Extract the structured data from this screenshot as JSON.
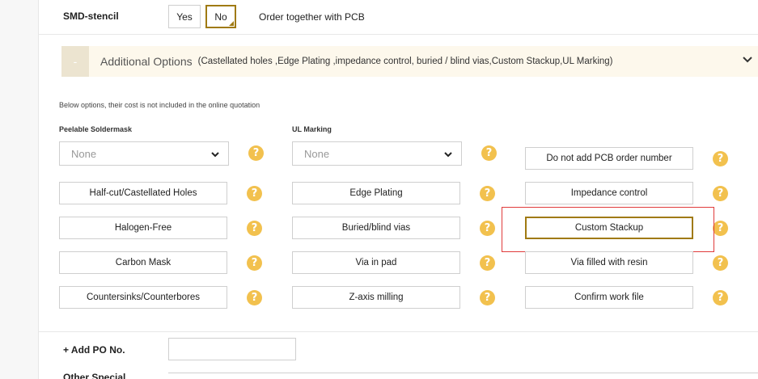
{
  "smd_stencil": {
    "label": "SMD-stencil",
    "yes_label": "Yes",
    "no_label": "No",
    "selected": "No",
    "note": "Order together with PCB"
  },
  "additional_options": {
    "toggle_symbol": "-",
    "title": "Additional Options",
    "subtitle": "(Castellated holes ,Edge Plating ,impedance control, buried / blind vias,Custom Stackup,UL Marking)"
  },
  "note": "Below options, their cost is not included in the online quotation",
  "peelable": {
    "label": "Peelable Soldermask",
    "value": "None"
  },
  "ul_marking": {
    "label": "UL Marking",
    "value": "None"
  },
  "help_symbol": "?",
  "options": {
    "no_order_number": "Do not add PCB order number",
    "half_cut": "Half-cut/Castellated Holes",
    "edge_plating": "Edge Plating",
    "impedance": "Impedance control",
    "halogen_free": "Halogen-Free",
    "buried_blind": "Buried/blind vias",
    "custom_stackup": "Custom Stackup",
    "carbon_mask": "Carbon Mask",
    "via_in_pad": "Via in pad",
    "via_filled": "Via filled with resin",
    "countersinks": "Countersinks/Counterbores",
    "z_axis": "Z-axis milling",
    "confirm_work_file": "Confirm work file"
  },
  "po": {
    "label": "+ Add PO No.",
    "value": ""
  },
  "other_special": {
    "label": "Other Special"
  },
  "colors": {
    "accent": "#a07a12",
    "help": "#f2c14e",
    "banner_bg": "#fdf8ec",
    "highlight": "#e03b3b"
  }
}
